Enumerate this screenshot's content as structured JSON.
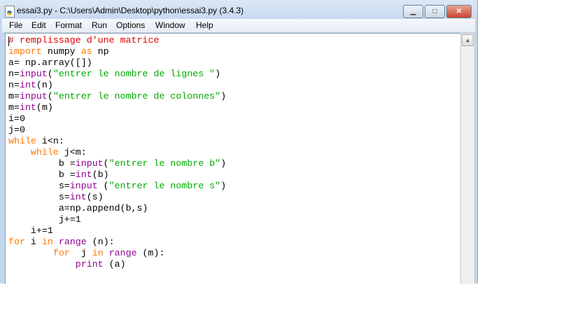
{
  "window": {
    "title": "essai3.py - C:\\Users\\Admin\\Desktop\\python\\essai3.py (3.4.3)",
    "minimize": "▁",
    "maximize": "□",
    "close": "✕"
  },
  "menu": [
    "File",
    "Edit",
    "Format",
    "Run",
    "Options",
    "Window",
    "Help"
  ],
  "scroll_up": "▲",
  "code": [
    [
      [
        "# remplissage d'une matrice",
        "cm"
      ]
    ],
    [
      [
        "import",
        "kw"
      ],
      [
        " numpy ",
        "df"
      ],
      [
        "as",
        "kw"
      ],
      [
        " np",
        "df"
      ]
    ],
    [
      [
        "a= np.array([])",
        "df"
      ]
    ],
    [
      [
        "n=",
        "df"
      ],
      [
        "input",
        "bi"
      ],
      [
        "(",
        "df"
      ],
      [
        "\"entrer le nombre de lignes \"",
        "st"
      ],
      [
        ")",
        "df"
      ]
    ],
    [
      [
        "n=",
        "df"
      ],
      [
        "int",
        "bi"
      ],
      [
        "(n)",
        "df"
      ]
    ],
    [
      [
        "m=",
        "df"
      ],
      [
        "input",
        "bi"
      ],
      [
        "(",
        "df"
      ],
      [
        "\"entrer le nombre de colonnes\"",
        "st"
      ],
      [
        ")",
        "df"
      ]
    ],
    [
      [
        "m=",
        "df"
      ],
      [
        "int",
        "bi"
      ],
      [
        "(m)",
        "df"
      ]
    ],
    [
      [
        "i=0",
        "df"
      ]
    ],
    [
      [
        "j=0",
        "df"
      ]
    ],
    [
      [
        "while",
        "kw"
      ],
      [
        " i<n:",
        "df"
      ]
    ],
    [
      [
        "    ",
        "df"
      ],
      [
        "while",
        "kw"
      ],
      [
        " j<m:",
        "df"
      ]
    ],
    [
      [
        "         b =",
        "df"
      ],
      [
        "input",
        "bi"
      ],
      [
        "(",
        "df"
      ],
      [
        "\"entrer le nombre b\"",
        "st"
      ],
      [
        ")",
        "df"
      ]
    ],
    [
      [
        "         b =",
        "df"
      ],
      [
        "int",
        "bi"
      ],
      [
        "(b)",
        "df"
      ]
    ],
    [
      [
        "         s=",
        "df"
      ],
      [
        "input",
        "bi"
      ],
      [
        " (",
        "df"
      ],
      [
        "\"entrer le nombre s\"",
        "st"
      ],
      [
        ")",
        "df"
      ]
    ],
    [
      [
        "         s=",
        "df"
      ],
      [
        "int",
        "bi"
      ],
      [
        "(s)",
        "df"
      ]
    ],
    [
      [
        "         a=np.append(b,s)",
        "df"
      ]
    ],
    [
      [
        "         j+=1",
        "df"
      ]
    ],
    [
      [
        "    i+=1",
        "df"
      ]
    ],
    [
      [
        "for",
        "kw"
      ],
      [
        " i ",
        "df"
      ],
      [
        "in",
        "kw"
      ],
      [
        " ",
        "df"
      ],
      [
        "range",
        "bi"
      ],
      [
        " (n):",
        "df"
      ]
    ],
    [
      [
        "        ",
        "df"
      ],
      [
        "for",
        "kw"
      ],
      [
        "  j ",
        "df"
      ],
      [
        "in",
        "kw"
      ],
      [
        " ",
        "df"
      ],
      [
        "range",
        "bi"
      ],
      [
        " (m):",
        "df"
      ]
    ],
    [
      [
        "            ",
        "df"
      ],
      [
        "print",
        "bi"
      ],
      [
        " (a)",
        "df"
      ]
    ]
  ]
}
